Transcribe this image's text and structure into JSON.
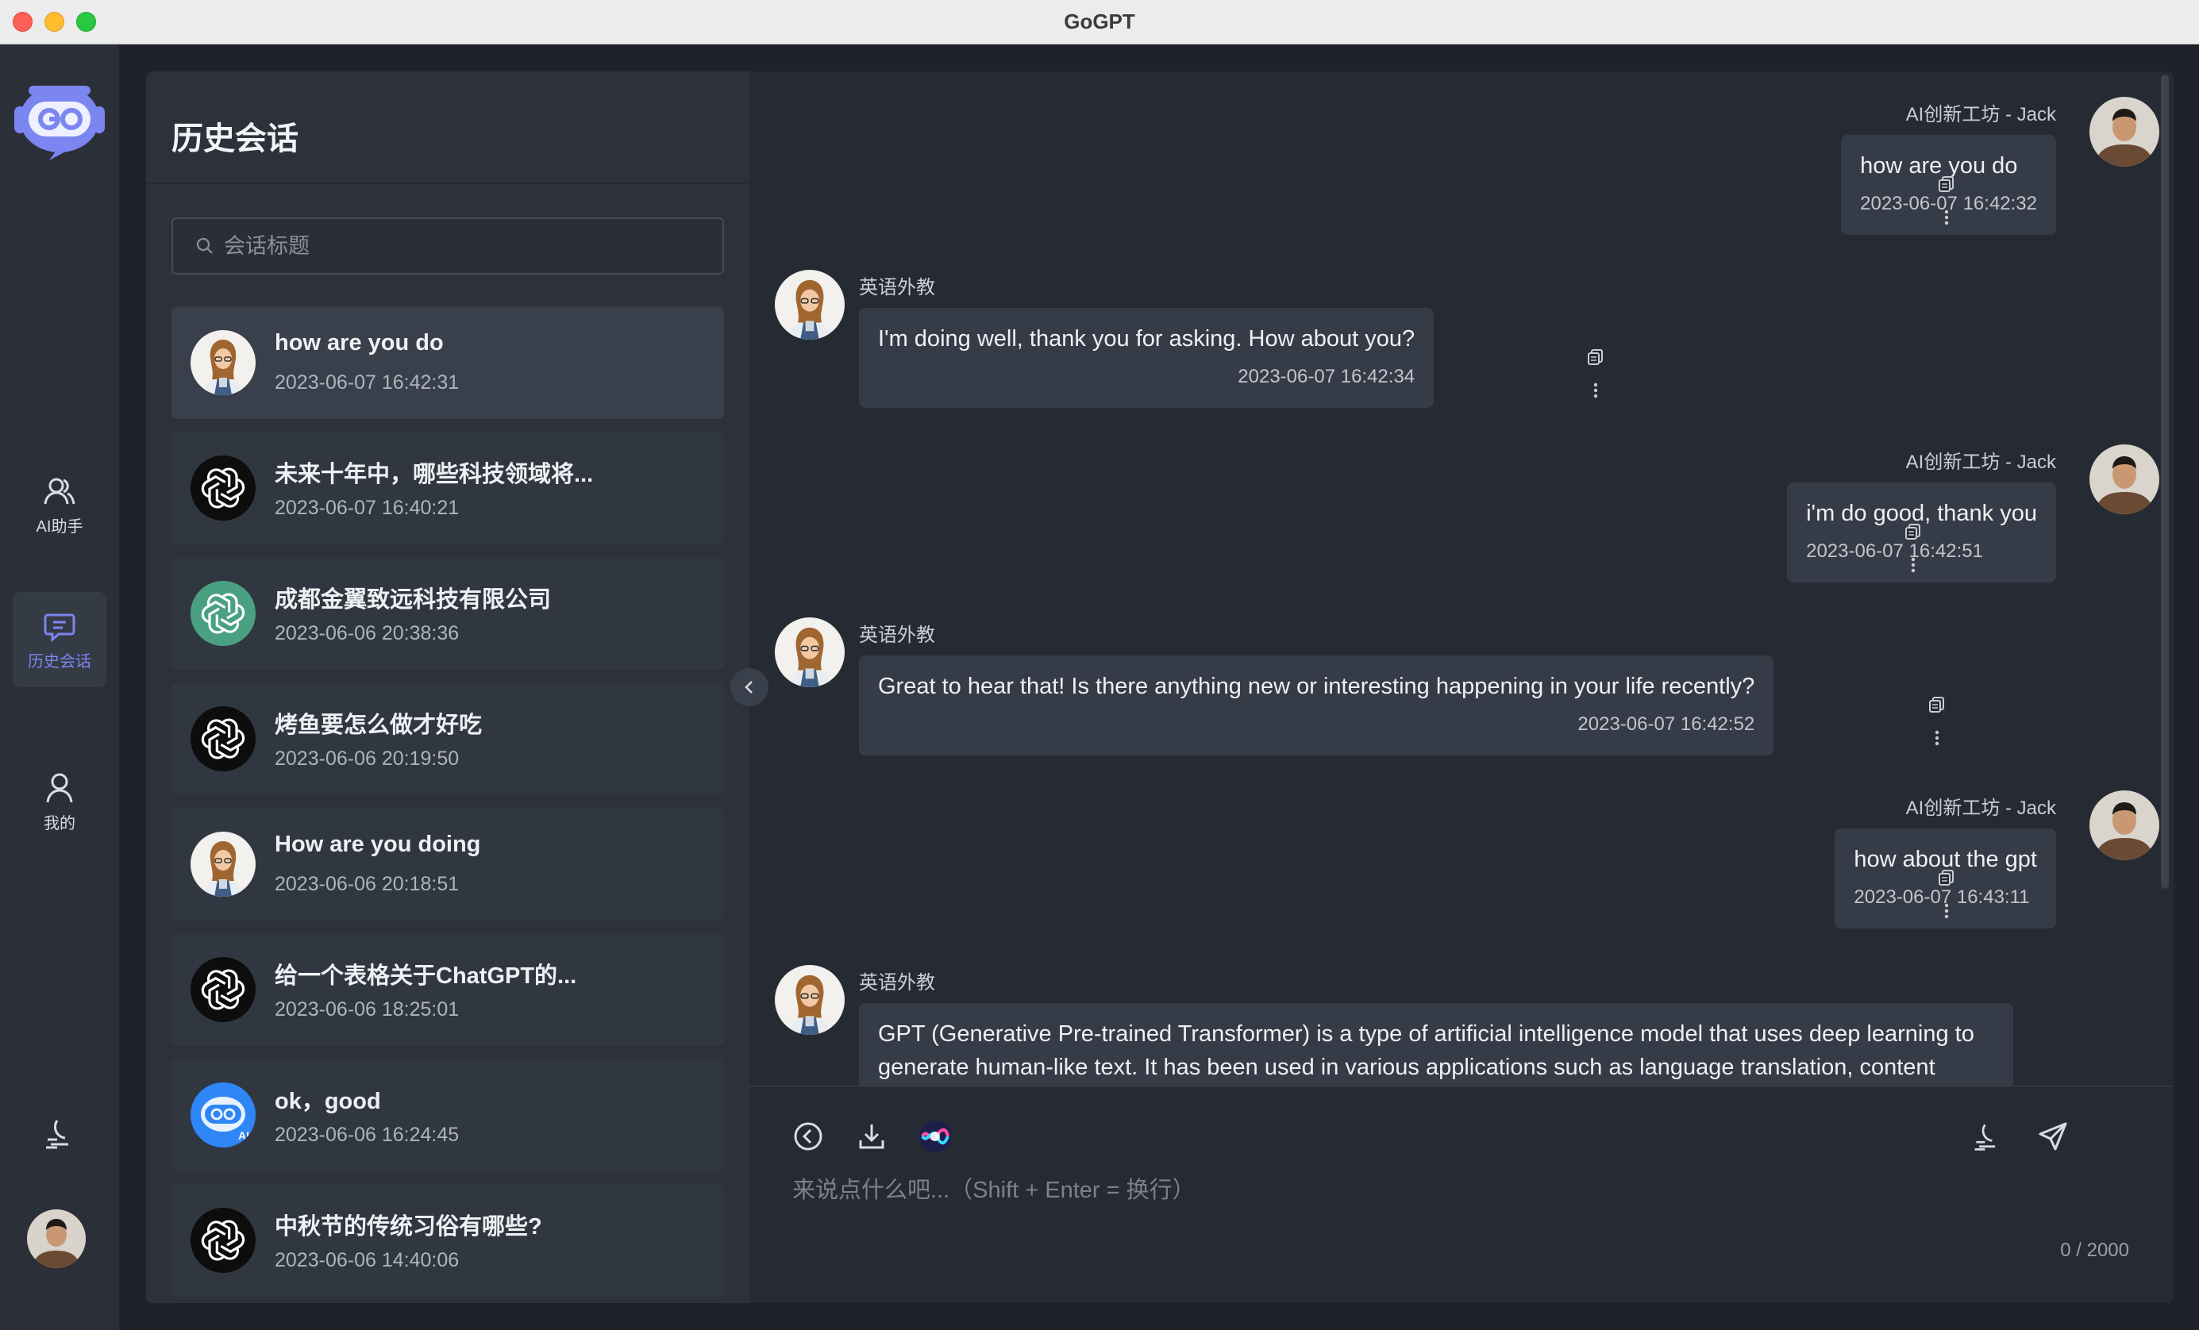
{
  "window": {
    "title": "GoGPT"
  },
  "nav": {
    "items": [
      {
        "label": "AI助手",
        "icon": "users-icon"
      },
      {
        "label": "历史会话",
        "icon": "chat-icon"
      },
      {
        "label": "我的",
        "icon": "user-icon"
      }
    ],
    "active": "历史会话",
    "theme_icon": "moon-icon"
  },
  "history": {
    "title": "历史会话",
    "search_placeholder": "会话标题",
    "items": [
      {
        "title": "how are you do",
        "time": "2023-06-07 16:42:31",
        "avatar": "teacher"
      },
      {
        "title": "未来十年中，哪些科技领域将...",
        "time": "2023-06-07 16:40:21",
        "avatar": "openai-dark"
      },
      {
        "title": "成都金翼致远科技有限公司",
        "time": "2023-06-06 20:38:36",
        "avatar": "openai-green"
      },
      {
        "title": "烤鱼要怎么做才好吃",
        "time": "2023-06-06 20:19:50",
        "avatar": "openai-dark"
      },
      {
        "title": "How are you doing",
        "time": "2023-06-06 20:18:51",
        "avatar": "teacher"
      },
      {
        "title": "给一个表格关于ChatGPT的...",
        "time": "2023-06-06 18:25:01",
        "avatar": "openai-dark"
      },
      {
        "title": "ok，good",
        "time": "2023-06-06 16:24:45",
        "avatar": "gogpt-bot"
      },
      {
        "title": "中秋节的传统习俗有哪些?",
        "time": "2023-06-06 14:40:06",
        "avatar": "openai-dark"
      }
    ]
  },
  "chat": {
    "messages": [
      {
        "role": "user",
        "name": "AI创新工坊 - Jack",
        "text": "how are you do",
        "time": "2023-06-07 16:42:32"
      },
      {
        "role": "bot",
        "name": "英语外教",
        "text": "I'm doing well, thank you for asking. How about you?",
        "time": "2023-06-07 16:42:34"
      },
      {
        "role": "user",
        "name": "AI创新工坊 - Jack",
        "text": "i'm do good, thank you",
        "time": "2023-06-07 16:42:51"
      },
      {
        "role": "bot",
        "name": "英语外教",
        "text": "Great to hear that! Is there anything new or interesting happening in your life recently?",
        "time": "2023-06-07 16:42:52"
      },
      {
        "role": "user",
        "name": "AI创新工坊 - Jack",
        "text": "how about the gpt",
        "time": "2023-06-07 16:43:11"
      },
      {
        "role": "bot",
        "name": "英语外教",
        "text": "GPT (Generative Pre-trained Transformer) is a type of artificial intelligence model that uses deep learning to generate human-like text. It has been used in various applications such as language translation, content"
      }
    ]
  },
  "composer": {
    "placeholder": "来说点什么吧...（Shift + Enter = 换行）",
    "count": "0 / 2000"
  },
  "colors": {
    "accent": "#7b86f0",
    "panel": "#262b33",
    "sidebar": "#2c313a",
    "bubble": "#363c47"
  }
}
